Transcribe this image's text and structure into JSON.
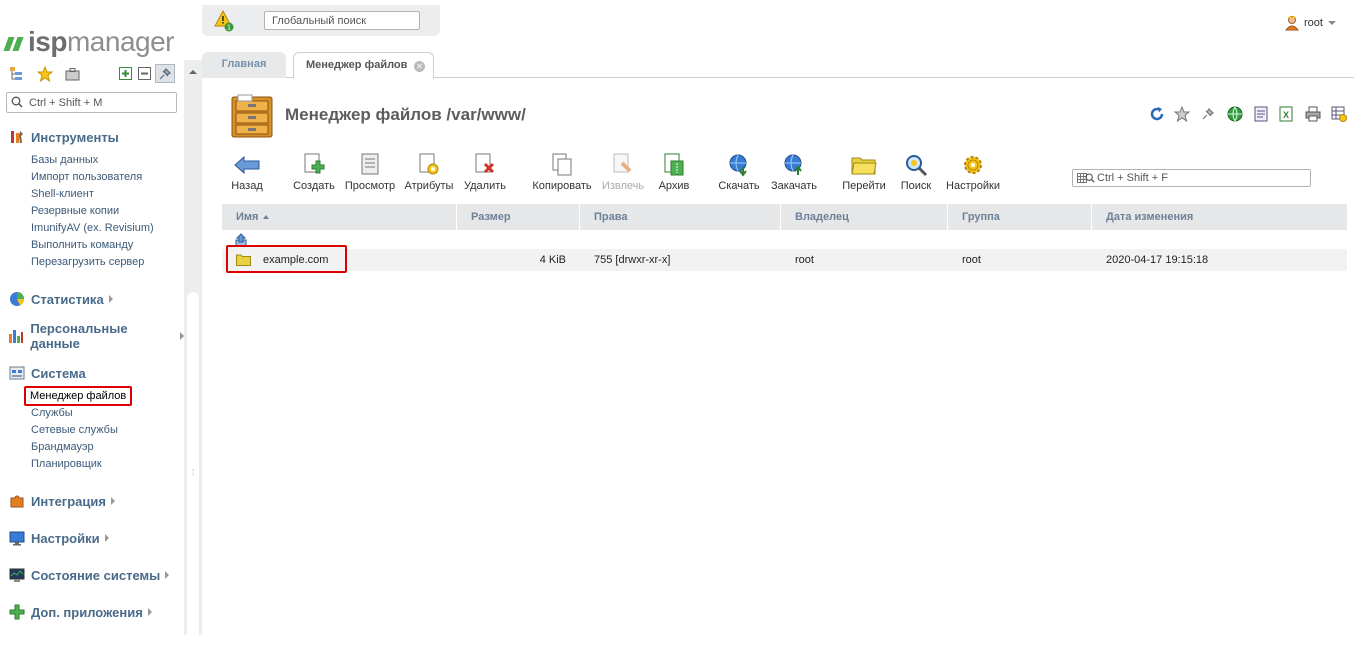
{
  "brand": {
    "logo_isp": "isp",
    "logo_manager": "manager"
  },
  "sidebar": {
    "search_placeholder": "Ctrl + Shift + M",
    "groups": [
      {
        "title": "Инструменты",
        "items": [
          "Базы данных",
          "Импорт пользователя",
          "Shell-клиент",
          "Резервные копии",
          "ImunifyAV (ex. Revisium)",
          "Выполнить команду",
          "Перезагрузить сервер"
        ]
      },
      {
        "title": "Статистика",
        "items": []
      },
      {
        "title": "Персональные данные",
        "items": []
      },
      {
        "title": "Система",
        "items": [
          "Менеджер файлов",
          "Службы",
          "Сетевые службы",
          "Брандмауэр",
          "Планировщик"
        ],
        "active_item": "Менеджер файлов"
      },
      {
        "title": "Интеграция",
        "items": []
      },
      {
        "title": "Настройки",
        "items": []
      },
      {
        "title": "Состояние системы",
        "items": []
      },
      {
        "title": "Доп. приложения",
        "items": []
      }
    ]
  },
  "header": {
    "global_search_placeholder": "Глобальный поиск",
    "alert_count": "1",
    "user": "root"
  },
  "tabs": [
    {
      "label": "Главная",
      "active": false
    },
    {
      "label": "Менеджер файлов",
      "active": true
    }
  ],
  "page": {
    "title": "Менеджер файлов /var/www/"
  },
  "toolbar": {
    "buttons": [
      {
        "label": "Назад",
        "icon": "back-arrow-icon"
      },
      {
        "label": "Создать",
        "icon": "new-file-icon"
      },
      {
        "label": "Просмотр",
        "icon": "view-icon"
      },
      {
        "label": "Атрибуты",
        "icon": "attributes-icon"
      },
      {
        "label": "Удалить",
        "icon": "delete-icon"
      },
      {
        "label": "Копировать",
        "icon": "copy-icon"
      },
      {
        "label": "Извлечь",
        "icon": "extract-icon",
        "disabled": true
      },
      {
        "label": "Архив",
        "icon": "archive-icon"
      },
      {
        "label": "Скачать",
        "icon": "download-icon"
      },
      {
        "label": "Закачать",
        "icon": "upload-icon"
      },
      {
        "label": "Перейти",
        "icon": "folder-icon"
      },
      {
        "label": "Поиск",
        "icon": "magnifier-icon"
      },
      {
        "label": "Настройки",
        "icon": "gear-icon"
      }
    ],
    "filter_placeholder": "Ctrl + Shift + F"
  },
  "table": {
    "columns": [
      "Имя",
      "Размер",
      "Права",
      "Владелец",
      "Группа",
      "Дата изменения"
    ],
    "rows": [
      {
        "name": "example.com",
        "size": "4 KiB",
        "perms": "755 [drwxr-xr-x]",
        "owner": "root",
        "group": "root",
        "modified": "2020-04-17 19:15:18"
      }
    ]
  },
  "colors": {
    "accent_link": "#3c5a78",
    "header_text": "#6d8197",
    "highlight_box": "#dd0000",
    "logo_green": "#4caf50"
  }
}
